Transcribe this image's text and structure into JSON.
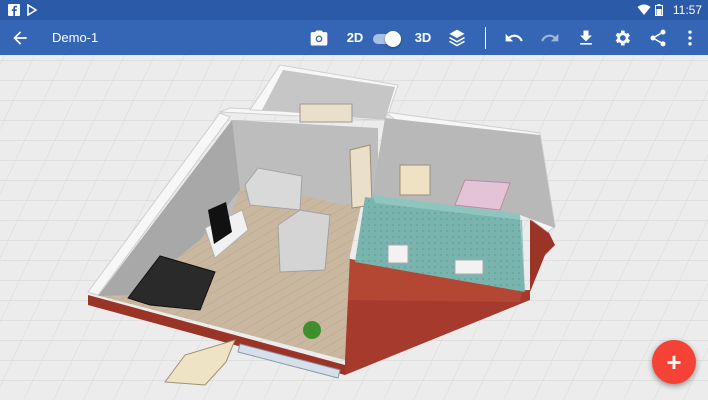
{
  "status_bar": {
    "time": "11:57",
    "left_icons": [
      "facebook-icon",
      "app-notification-icon"
    ],
    "right_icons": [
      "wifi-icon",
      "battery-icon"
    ]
  },
  "toolbar": {
    "back_icon": "back-arrow-icon",
    "title": "Demo-1",
    "camera_icon": "camera-icon",
    "label_2d": "2D",
    "label_3d": "3D",
    "view_mode": "3D",
    "layers_icon": "layers-icon",
    "undo_icon": "undo-icon",
    "redo_icon": "redo-icon",
    "download_icon": "download-icon",
    "settings_icon": "gear-icon",
    "share_icon": "share-icon",
    "more_icon": "more-vert-icon",
    "accent": "#3566b5"
  },
  "fab": {
    "label": "+",
    "color": "#f44336",
    "icon": "add-icon"
  }
}
